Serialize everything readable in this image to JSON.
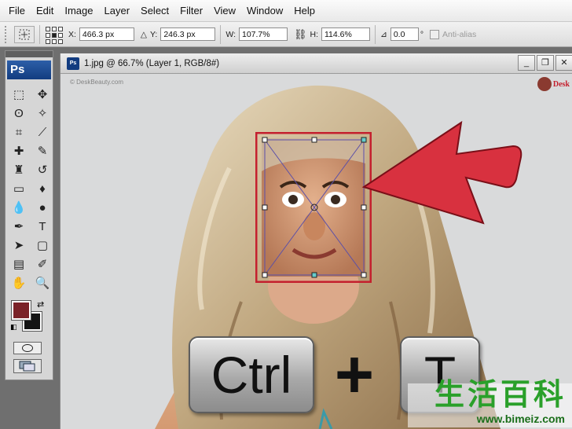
{
  "menubar": {
    "items": [
      "File",
      "Edit",
      "Image",
      "Layer",
      "Select",
      "Filter",
      "View",
      "Window",
      "Help"
    ]
  },
  "options": {
    "x_label": "X:",
    "x_value": "466.3 px",
    "y_label": "Y:",
    "y_value": "246.3 px",
    "w_label": "W:",
    "w_value": "107.7%",
    "h_label": "H:",
    "h_value": "114.6%",
    "angle_value": "0.0",
    "degree_symbol": "°",
    "antialias_label": "Anti-alias"
  },
  "toolbox": {
    "logo": "Ps",
    "tools": [
      {
        "name": "marquee-tool",
        "glyph": "⬚"
      },
      {
        "name": "move-tool",
        "glyph": "✥"
      },
      {
        "name": "lasso-tool",
        "glyph": "ʘ"
      },
      {
        "name": "magic-wand-tool",
        "glyph": "✧"
      },
      {
        "name": "crop-tool",
        "glyph": "⌗"
      },
      {
        "name": "slice-tool",
        "glyph": "⟋"
      },
      {
        "name": "healing-brush-tool",
        "glyph": "✚"
      },
      {
        "name": "brush-tool",
        "glyph": "✎"
      },
      {
        "name": "clone-stamp-tool",
        "glyph": "♜"
      },
      {
        "name": "history-brush-tool",
        "glyph": "↺"
      },
      {
        "name": "eraser-tool",
        "glyph": "▭"
      },
      {
        "name": "paint-bucket-tool",
        "glyph": "♦"
      },
      {
        "name": "blur-tool",
        "glyph": "💧"
      },
      {
        "name": "dodge-tool",
        "glyph": "●"
      },
      {
        "name": "pen-tool",
        "glyph": "✒"
      },
      {
        "name": "type-tool",
        "glyph": "T"
      },
      {
        "name": "path-selection-tool",
        "glyph": "➤"
      },
      {
        "name": "shape-tool",
        "glyph": "▢"
      },
      {
        "name": "notes-tool",
        "glyph": "▤"
      },
      {
        "name": "eyedropper-tool",
        "glyph": "✐"
      },
      {
        "name": "hand-tool",
        "glyph": "✋"
      },
      {
        "name": "zoom-tool",
        "glyph": "🔍"
      }
    ],
    "foreground_color": "#7b2228",
    "background_color": "#141414"
  },
  "document": {
    "title": "1.jpg @ 66.7% (Layer 1, RGB/8#)",
    "win_buttons": [
      "_",
      "❐",
      "✕"
    ],
    "watermark_tl": "© DeskBeauty.com",
    "brand_tr": "Desk",
    "key_ctrl": "Ctrl",
    "key_plus": "+",
    "key_t": "T",
    "watermark_cn": "生活百科",
    "watermark_url": "www.bimeiz.com"
  },
  "colors": {
    "arrow_red": "#d8313f",
    "transform_box_red": "#c4202e",
    "bimeiz_green": "#2aa02a"
  }
}
